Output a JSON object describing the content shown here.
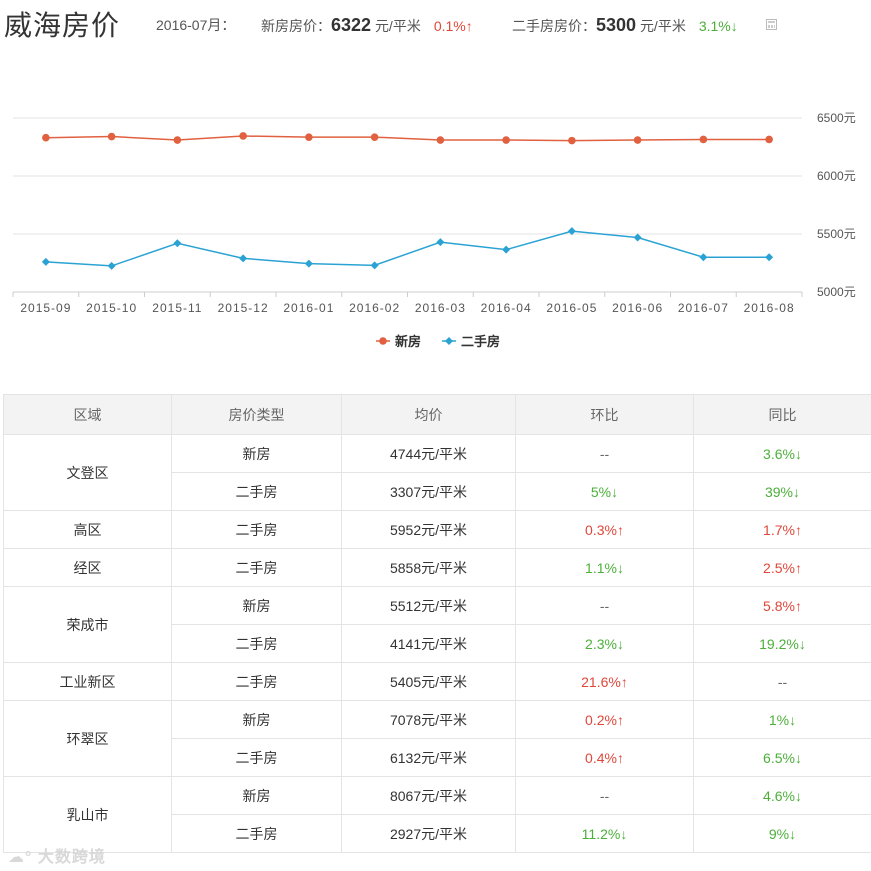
{
  "header": {
    "city_title": "威海房价",
    "month_label": "2016-07月：",
    "new_label": "新房房价：",
    "new_price": "6322",
    "new_unit": "元/平米",
    "new_change": "0.1%↑",
    "second_label": "二手房房价：",
    "second_price": "5300",
    "second_unit": "元/平米",
    "second_change": "3.1%↓"
  },
  "chart_data": {
    "type": "line",
    "categories": [
      "2015-09",
      "2015-10",
      "2015-11",
      "2015-12",
      "2016-01",
      "2016-02",
      "2016-03",
      "2016-04",
      "2016-05",
      "2016-06",
      "2016-07",
      "2016-08"
    ],
    "series": [
      {
        "name": "新房",
        "color": "#e0603f",
        "marker": "circle",
        "values": [
          6330,
          6340,
          6310,
          6345,
          6335,
          6335,
          6310,
          6310,
          6305,
          6310,
          6315,
          6315
        ]
      },
      {
        "name": "二手房",
        "color": "#2aa3d4",
        "marker": "diamond",
        "values": [
          5260,
          5225,
          5420,
          5290,
          5245,
          5230,
          5430,
          5365,
          5525,
          5470,
          5300,
          5300
        ]
      }
    ],
    "yticks": [
      "6500元",
      "6000元",
      "5500元",
      "5000元"
    ],
    "ytick_values": [
      6500,
      6000,
      5500,
      5000
    ],
    "ylim": [
      5000,
      6500
    ],
    "grid": true,
    "legend_position": "bottom"
  },
  "table": {
    "headers": [
      "区域",
      "房价类型",
      "均价",
      "环比",
      "同比"
    ],
    "rows": [
      {
        "region": "文登区",
        "rowspan": 2,
        "type": "新房",
        "price": "4744元/平米",
        "mom": "--",
        "mom_dir": "none",
        "yoy": "3.6%↓",
        "yoy_dir": "down"
      },
      {
        "type": "二手房",
        "price": "3307元/平米",
        "mom": "5%↓",
        "mom_dir": "down",
        "yoy": "39%↓",
        "yoy_dir": "down"
      },
      {
        "region": "高区",
        "rowspan": 1,
        "type": "二手房",
        "price": "5952元/平米",
        "mom": "0.3%↑",
        "mom_dir": "up",
        "yoy": "1.7%↑",
        "yoy_dir": "up"
      },
      {
        "region": "经区",
        "rowspan": 1,
        "type": "二手房",
        "price": "5858元/平米",
        "mom": "1.1%↓",
        "mom_dir": "down",
        "yoy": "2.5%↑",
        "yoy_dir": "up"
      },
      {
        "region": "荣成市",
        "rowspan": 2,
        "type": "新房",
        "price": "5512元/平米",
        "mom": "--",
        "mom_dir": "none",
        "yoy": "5.8%↑",
        "yoy_dir": "up"
      },
      {
        "type": "二手房",
        "price": "4141元/平米",
        "mom": "2.3%↓",
        "mom_dir": "down",
        "yoy": "19.2%↓",
        "yoy_dir": "down"
      },
      {
        "region": "工业新区",
        "rowspan": 1,
        "type": "二手房",
        "price": "5405元/平米",
        "mom": "21.6%↑",
        "mom_dir": "up",
        "yoy": "--",
        "yoy_dir": "none"
      },
      {
        "region": "环翠区",
        "rowspan": 2,
        "type": "新房",
        "price": "7078元/平米",
        "mom": "0.2%↑",
        "mom_dir": "up",
        "yoy": "1%↓",
        "yoy_dir": "down"
      },
      {
        "type": "二手房",
        "price": "6132元/平米",
        "mom": "0.4%↑",
        "mom_dir": "up",
        "yoy": "6.5%↓",
        "yoy_dir": "down"
      },
      {
        "region": "乳山市",
        "rowspan": 2,
        "type": "新房",
        "price": "8067元/平米",
        "mom": "--",
        "mom_dir": "none",
        "yoy": "4.6%↓",
        "yoy_dir": "down"
      },
      {
        "type": "二手房",
        "price": "2927元/平米",
        "mom": "11.2%↓",
        "mom_dir": "down",
        "yoy": "9%↓",
        "yoy_dir": "down"
      }
    ]
  },
  "watermark": "大数跨境",
  "colors": {
    "up": "#e0473a",
    "down": "#4caf3a",
    "new_series": "#e0603f",
    "second_series": "#2aa3d4"
  }
}
